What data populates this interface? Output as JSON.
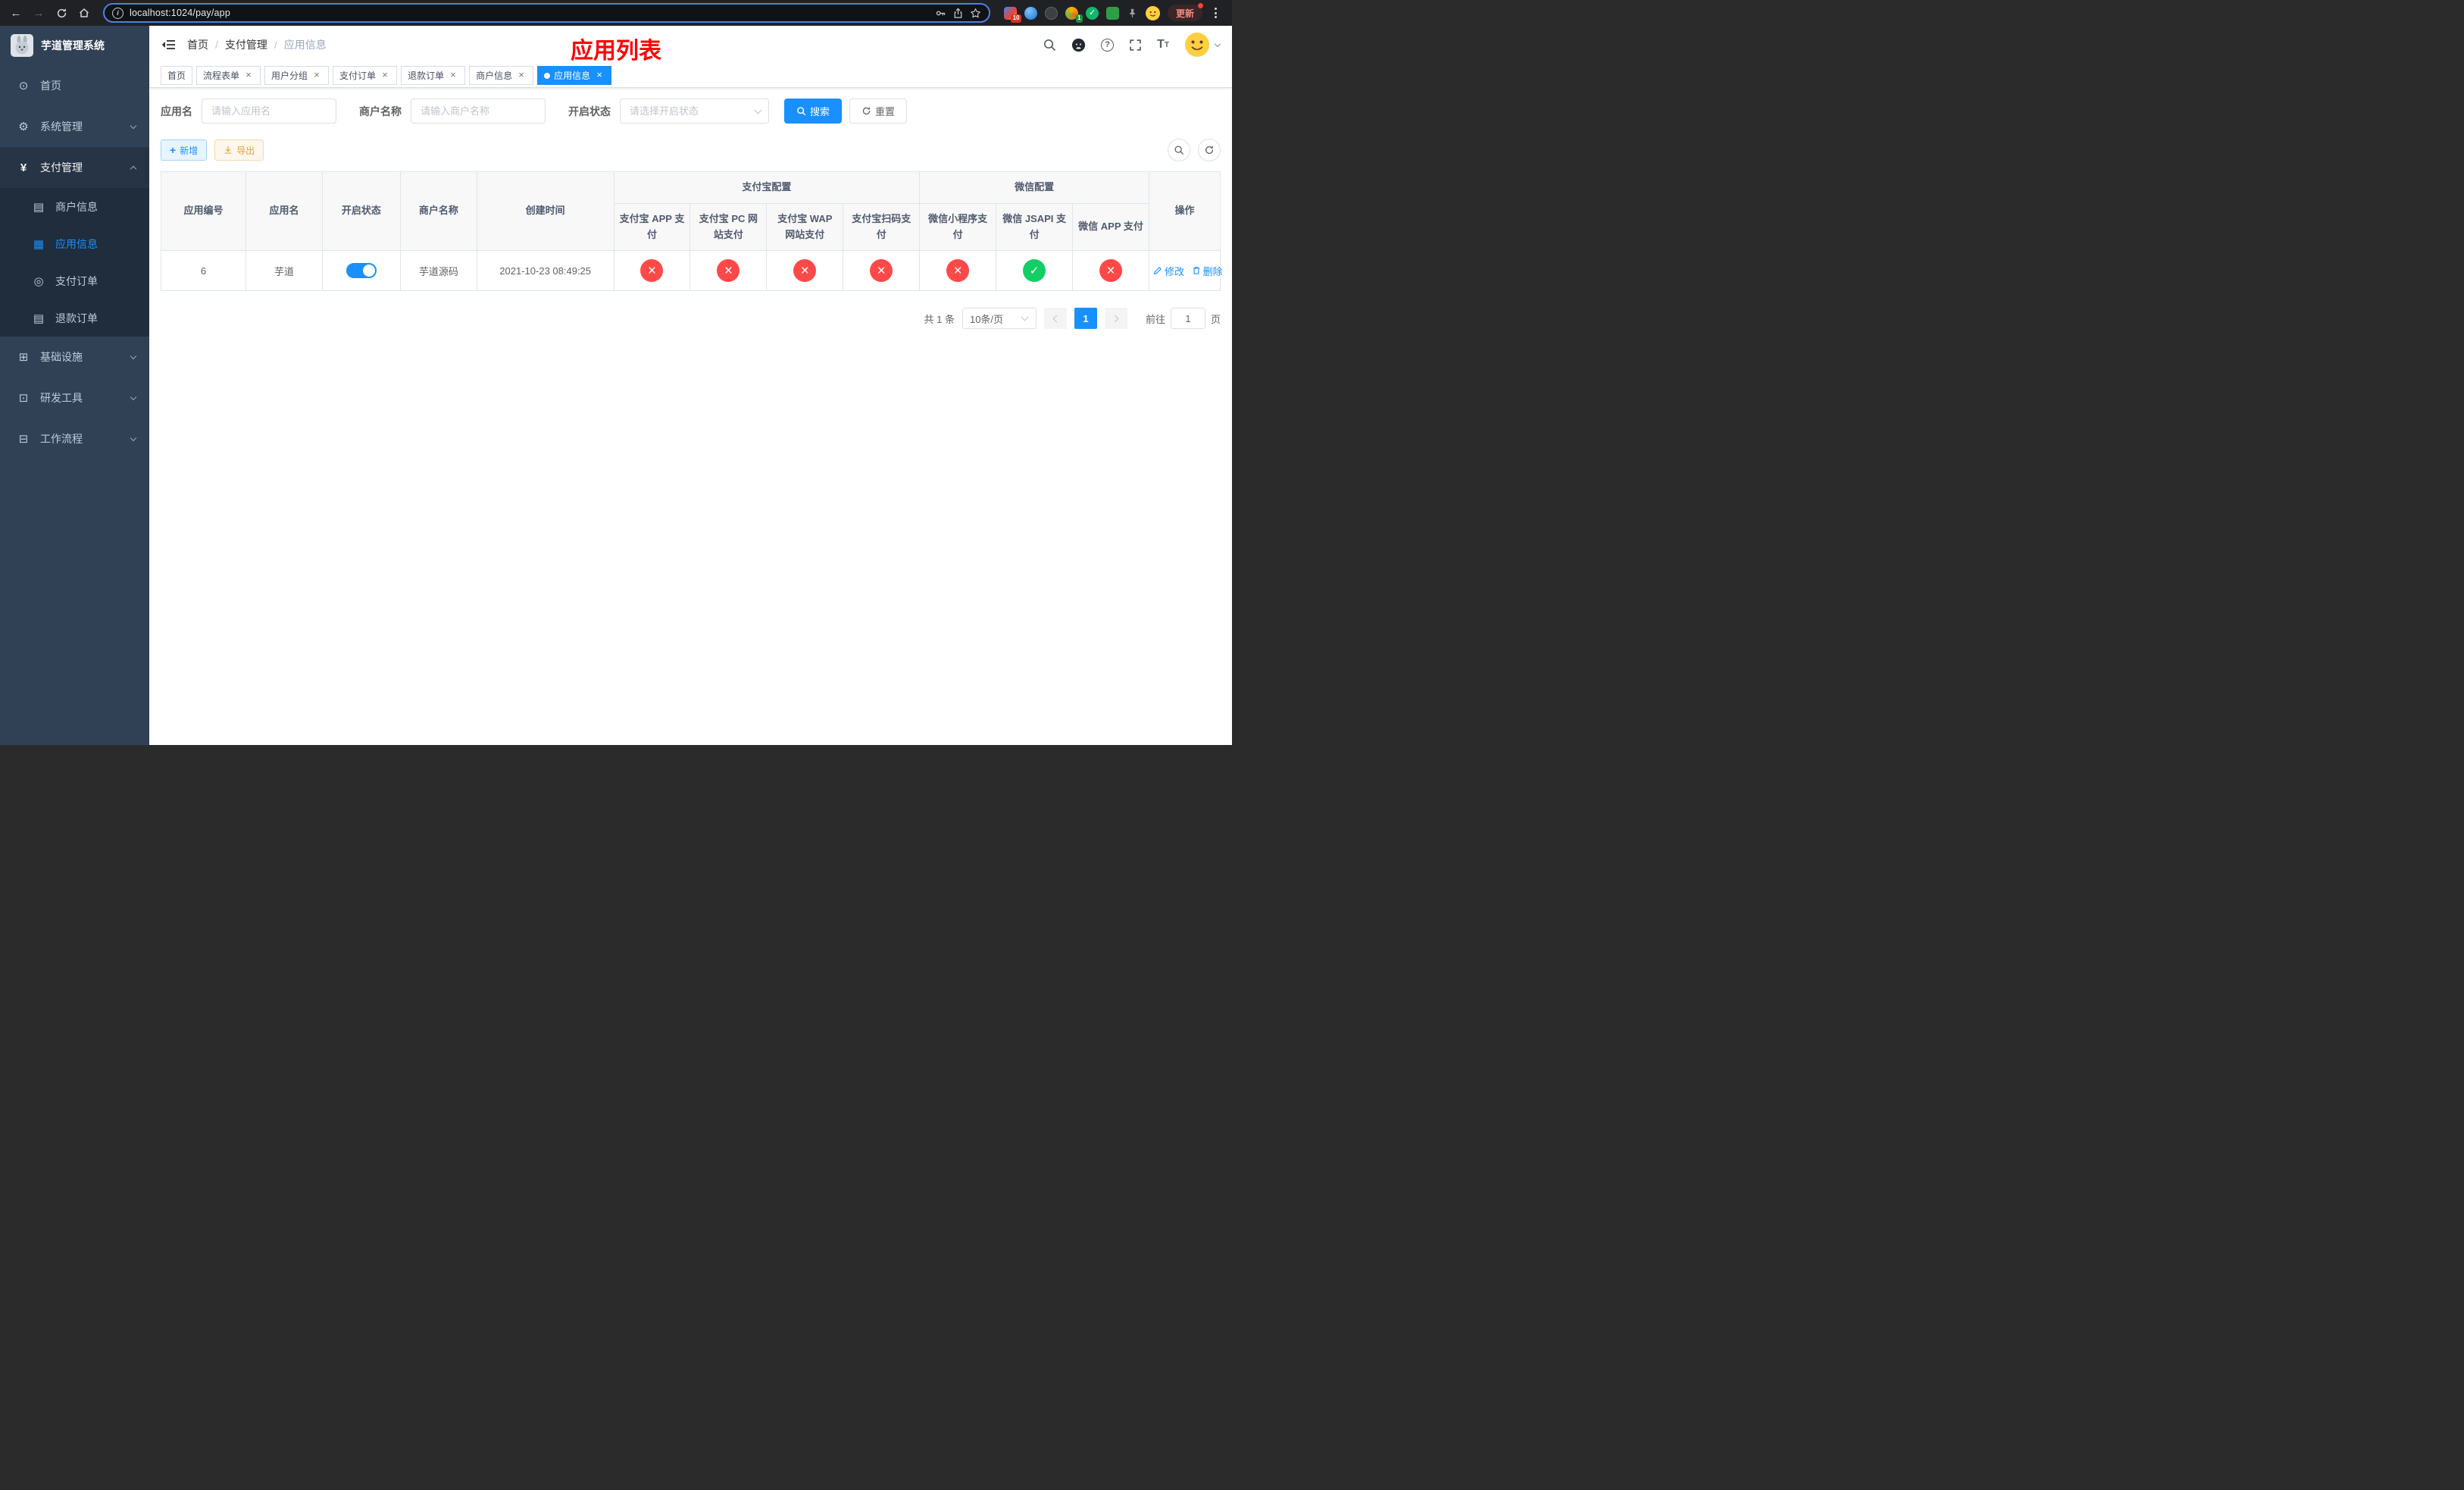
{
  "colors": {
    "primary": "#1890ff",
    "success": "#13ce66",
    "danger": "#ff4949",
    "warning": "#e6a23c",
    "banner": "#ff0000",
    "sidebar-bg": "#304156",
    "sidebar-sub-bg": "#1f2d3d",
    "sidebar-active-bg": "#263445"
  },
  "browser": {
    "url": "localhost:1024/pay/app",
    "update_label": "更新",
    "ext_badge_count": "10",
    "profile_badge_count": "1"
  },
  "sidebar": {
    "title": "芋道管理系统",
    "menu": [
      {
        "label": "首页"
      },
      {
        "label": "系统管理"
      },
      {
        "label": "支付管理"
      },
      {
        "label": "商户信息"
      },
      {
        "label": "应用信息"
      },
      {
        "label": "支付订单"
      },
      {
        "label": "退款订单"
      },
      {
        "label": "基础设施"
      },
      {
        "label": "研发工具"
      },
      {
        "label": "工作流程"
      }
    ]
  },
  "header": {
    "breadcrumb": [
      "首页",
      "支付管理",
      "应用信息"
    ],
    "banner": "应用列表"
  },
  "tabs": [
    {
      "label": "首页"
    },
    {
      "label": "流程表单"
    },
    {
      "label": "用户分组"
    },
    {
      "label": "支付订单"
    },
    {
      "label": "退款订单"
    },
    {
      "label": "商户信息"
    },
    {
      "label": "应用信息"
    }
  ],
  "filters": {
    "app_name_label": "应用名",
    "app_name_placeholder": "请输入应用名",
    "merchant_label": "商户名称",
    "merchant_placeholder": "请输入商户名称",
    "status_label": "开启状态",
    "status_placeholder": "请选择开启状态",
    "search_button": "搜索",
    "reset_button": "重置"
  },
  "toolbar": {
    "add_button": "新增",
    "export_button": "导出"
  },
  "table": {
    "group_alipay": "支付宝配置",
    "group_wechat": "微信配置",
    "columns": [
      "应用编号",
      "应用名",
      "开启状态",
      "商户名称",
      "创建时间",
      "支付宝 APP 支付",
      "支付宝 PC 网站支付",
      "支付宝 WAP 网站支付",
      "支付宝扫码支付",
      "微信小程序支付",
      "微信 JSAPI 支付",
      "微信 APP 支付",
      "操作"
    ],
    "rows": [
      {
        "id": "6",
        "name": "芋道",
        "enabled": true,
        "merchant": "芋道源码",
        "created_at": "2021-10-23 08:49:25",
        "channels": [
          "no",
          "no",
          "no",
          "no",
          "no",
          "yes",
          "no"
        ],
        "edit_label": "修改",
        "delete_label": "删除"
      }
    ]
  },
  "pagination": {
    "total_text": "共 1 条",
    "page_size_text": "10条/页",
    "current_page": "1",
    "goto_label": "前往",
    "goto_value": "1",
    "page_suffix": "页"
  }
}
